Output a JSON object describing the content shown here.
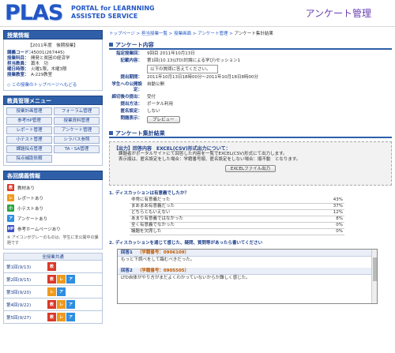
{
  "header": {
    "logo": "PLAS",
    "logo_sub_1": "PORTAL for LEARNNING",
    "logo_sub_2": "ASSISTED SERVICE",
    "page_title": "アンケート管理"
  },
  "sidebar": {
    "course_panel_title": "授業情報",
    "course_year": "【2011年度　後期授業】",
    "course_info": [
      {
        "k": "講義コード：",
        "v": "45001(267445)"
      },
      {
        "k": "授業科目：",
        "v": "開発と貧困の経済学"
      },
      {
        "k": "担当教員：",
        "v": "蕭木　功"
      },
      {
        "k": "曜日時限：",
        "v": "火曜1限，木曜3限"
      },
      {
        "k": "授業教室：",
        "v": "A-229教室"
      }
    ],
    "back_link": "◇ この授業のトップページへもどる",
    "menu_panel_title": "教員管理メニュー",
    "menu_items": [
      "授業計画管理",
      "フォーラム管理",
      "参考HP管理",
      "授業資料管理",
      "レポート管理",
      "アンケート管理",
      "小テスト管理",
      "シラバス参照",
      "課題採点管理",
      "TA・SA管理",
      "採点補助依頼"
    ],
    "legend_panel_title": "各回講義情報",
    "legend": [
      {
        "icon": "教",
        "label": "教材あり",
        "color": "#d83a2a"
      },
      {
        "icon": "レ",
        "label": "レポートあり",
        "color": "#f09a1c"
      },
      {
        "icon": "小",
        "label": "小テストあり",
        "color": "#2aa640"
      },
      {
        "icon": "ア",
        "label": "アンケートあり",
        "color": "#2f8ee0"
      },
      {
        "icon": "HP",
        "label": "参考ホームページあり",
        "color": "#3a52c8"
      }
    ],
    "legend_note": "※ アイコンがグレーのものは、学生に非公開中の課題です",
    "weeks_title": "全授業共通",
    "weeks": [
      {
        "label": "第1回(9/13)",
        "icons": [
          "教"
        ]
      },
      {
        "label": "第2回(9/15)",
        "icons": [
          "教",
          "レ",
          "ア"
        ]
      },
      {
        "label": "第3回(9/20)",
        "icons": [
          "レ",
          "ア"
        ]
      },
      {
        "label": "第4回(9/22)",
        "icons": [
          "教",
          "レ",
          "ア"
        ]
      },
      {
        "label": "第5回(9/27)",
        "icons": [
          "教",
          "レ",
          "ア"
        ]
      }
    ]
  },
  "main": {
    "breadcrumb": [
      "トップページ",
      "担当授業一覧",
      "授業画面",
      "アンケート管理"
    ],
    "breadcrumb_current": "アンケート集計結果",
    "survey_section_title": "アンケート内容",
    "survey_rows": [
      {
        "k": "指定授業回：",
        "v": "9回目  2011年10月13日"
      },
      {
        "k": "記載内容：",
        "v": "第1回(10.13)LTD(討論による学び)セッション1"
      }
    ],
    "survey_note": "以下の質問に答えてください。",
    "survey_rows_2": [
      {
        "k": "提出期間：",
        "v": "2011年10月13日18時00分〜2011年10月18日8時00分"
      },
      {
        "k": "学生への公開設定：",
        "v": "自動公開"
      },
      {
        "k": "締切後の提出：",
        "v": "受付"
      },
      {
        "k": "提出方法：",
        "v": "ポータル利用"
      },
      {
        "k": "匿名設定：",
        "v": "しない"
      }
    ],
    "preview_label": "問題表示：",
    "preview_button": "プレビュー",
    "result_section_title": "アンケート集計結果",
    "output_title": "【出力】回答内容　EXCEL(CSV)形式出力について：",
    "output_text_1": "課題者がポータルサイトにて回答した内容を一覧でEXCEL(CSV)形式にて出力します。",
    "output_text_2": "表示順は、匿名設定をした場合：学籍番号順、匿名設定をしない場合：順不動　となります。",
    "excel_button": "EXCELファイル出力",
    "q1_title": "1. ディスカッションは有意義でしたか？",
    "q1_rows": [
      {
        "label": "非常に有意義だった",
        "pct": "43%"
      },
      {
        "label": "まあまあ有意義だった",
        "pct": "37%"
      },
      {
        "label": "どちらともいえない",
        "pct": "12%"
      },
      {
        "label": "あまり有意義ではなかった",
        "pct": "8%"
      },
      {
        "label": "全く有意義でなかった",
        "pct": "0%"
      },
      {
        "label": "議題を欠席した",
        "pct": "0%"
      }
    ],
    "q2_title": "2. ディスカッションを通じて感じた、疑問、質問等があったら書いてください",
    "answers": [
      {
        "head": "回答1",
        "student": "（学籍番号：0906109）",
        "text": "もっと下調べをして臨むべきだった。"
      },
      {
        "head": "回答2",
        "student": "（学籍番号：0905505）",
        "text": "LTD自体がやり方がまだよくわかっていないからか難しく感じた。"
      }
    ]
  }
}
